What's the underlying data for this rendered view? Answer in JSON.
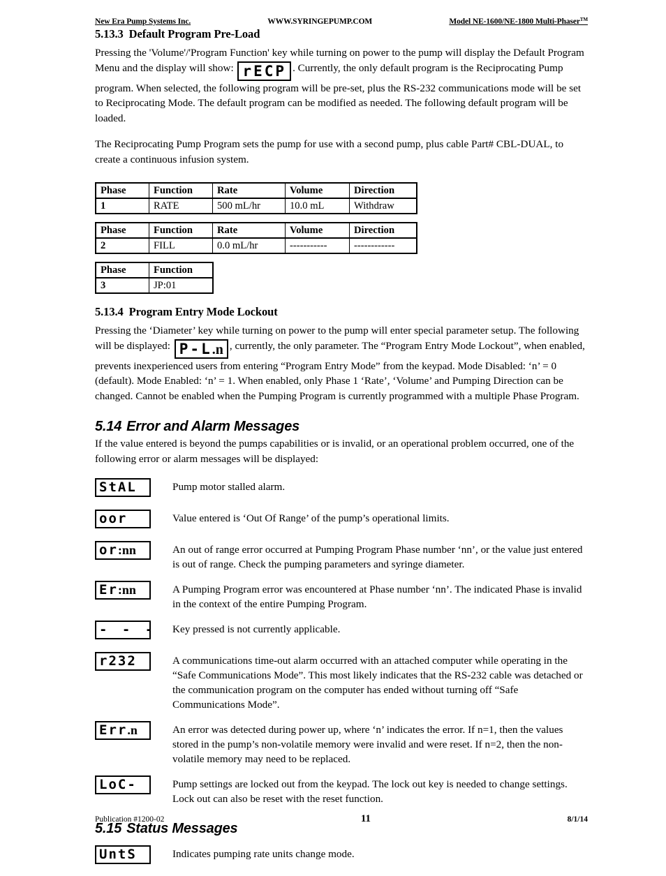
{
  "header": {
    "left": "New Era Pump Systems Inc.",
    "center": "WWW.SYRINGEPUMP.COM",
    "right": "Model NE-1600/NE-1800 Multi-Phaser",
    "right_tm": "TM"
  },
  "section_5_13_3": {
    "number": "5.13.3",
    "title": "Default Program Pre-Load",
    "para1_before": "Pressing the 'Volume'/'Program Function' key while turning on power to the pump will display the Default Program Menu and the display will show:",
    "lcd_display": "rECP",
    "para1_after": ". Currently, the only default program is the Reciprocating Pump program.   When selected, the following program will be pre-set, plus the RS-232 communications mode will be set to Reciprocating Mode.  The default program can be modified as needed.  The following default program will be loaded.",
    "para2": "The Reciprocating Pump Program sets the pump for use with a second pump, plus cable Part# CBL-DUAL, to create a continuous infusion system."
  },
  "tables": {
    "headers_full": [
      "Phase",
      "Function",
      "Rate",
      "Volume",
      "Direction"
    ],
    "headers_short": [
      "Phase",
      "Function"
    ],
    "table1_row": [
      "1",
      "RATE",
      "500 mL/hr",
      "10.0 mL",
      "Withdraw"
    ],
    "table2_row": [
      "2",
      "FILL",
      "0.0 mL/hr",
      "-----------",
      "------------"
    ],
    "table3_row": [
      "3",
      "JP:01"
    ]
  },
  "section_5_13_4": {
    "number": "5.13.4",
    "title": "Program Entry Mode Lockout",
    "para_before": "Pressing the ‘Diameter’ key while turning on power to the pump will enter special parameter setup.  The following will be displayed:",
    "lcd_display": "P-L.n",
    "para_after": ", currently, the only parameter.  The “Program Entry Mode Lockout”, when enabled, prevents inexperienced users from entering “Program Entry Mode” from the keypad.  Mode Disabled:  ‘n’ = 0 (default).  Mode Enabled:  ‘n’ = 1.  When enabled, only Phase 1 ‘Rate’, ‘Volume’ and Pumping Direction can be changed.  Cannot be enabled when the Pumping Program is currently programmed with a multiple Phase Program."
  },
  "section_5_14": {
    "number": "5.14",
    "title": "Error and Alarm Messages",
    "intro": "If the value entered is beyond the pumps capabilities or is invalid, or an operational problem occurred, one of the following error or alarm messages will be displayed:",
    "messages": [
      {
        "display": "StAL",
        "seg_part": "5EAL",
        "text": "Pump motor stalled alarm."
      },
      {
        "display": "oor",
        "seg_part": "oor",
        "text": "Value entered is ‘Out Of Range’ of the pump’s operational limits."
      },
      {
        "display": "or:nn",
        "seg_part": "or",
        "bold_part": "nn",
        "text": "An out of range error occurred at Pumping Program Phase number ‘nn’, or the value just entered is out of range.  Check the pumping parameters and syringe diameter."
      },
      {
        "display": "Er:nn",
        "seg_part": "Er",
        "bold_part": "nn",
        "text": "A Pumping Program error was encountered at Phase number ‘nn’.  The indicated Phase is invalid in the context of the entire Pumping Program."
      },
      {
        "display": "- - - -",
        "seg_part": "- - - -",
        "text": "Key pressed is not currently applicable."
      },
      {
        "display": "r232",
        "seg_part": "r232",
        "text": "A communications time-out alarm occurred with an attached computer while operating in the “Safe Communications Mode”.  This most likely indicates that the RS-232 cable was detached or the communication program on the computer has ended without turning off “Safe Communications Mode”."
      },
      {
        "display": "Err.n",
        "seg_part": "Err",
        "bold_part": "n",
        "text": "An error was detected during power up, where ‘n’ indicates the error.  If n=1, then the values stored in the pump’s non-volatile memory were invalid and were reset.  If n=2, then the non-volatile memory may need to be replaced."
      },
      {
        "display": "LoC-",
        "seg_part": "LoC-",
        "text": "Pump settings are locked out from the keypad.  The lock out key is needed to change settings.  Lock out can also be reset with the reset function."
      }
    ]
  },
  "section_5_15": {
    "number": "5.15",
    "title": "Status Messages",
    "messages": [
      {
        "display": "UntS",
        "seg_part": "UntS",
        "text": "Indicates pumping rate units change mode."
      }
    ]
  },
  "footer": {
    "publication": "Publication  #1200-02",
    "page": "11",
    "date": "8/1/14"
  }
}
